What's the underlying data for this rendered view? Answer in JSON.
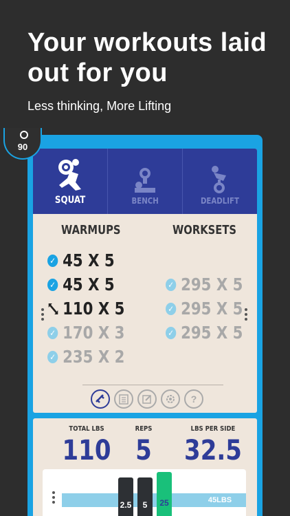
{
  "header": {
    "headline": "Your workouts laid out for you",
    "subline": "Less thinking, More Lifting"
  },
  "timer": {
    "value": "90"
  },
  "lifts": {
    "tabs": [
      {
        "label": "SQUAT",
        "active": true
      },
      {
        "label": "BENCH",
        "active": false
      },
      {
        "label": "DEADLIFT",
        "active": false
      }
    ]
  },
  "warmups": {
    "title": "WARMUPS",
    "sets": [
      {
        "text": "45 X 5",
        "status": "done"
      },
      {
        "text": "45 X 5",
        "status": "done"
      },
      {
        "text": "110 X 5",
        "status": "current"
      },
      {
        "text": "170 X 3",
        "status": "pending"
      },
      {
        "text": "235 X 2",
        "status": "pending"
      }
    ]
  },
  "worksets": {
    "title": "WORKSETS",
    "sets": [
      {
        "text": "295 X 5",
        "status": "pending"
      },
      {
        "text": "295 X 5",
        "status": "pending"
      },
      {
        "text": "295 X 5",
        "status": "pending"
      }
    ]
  },
  "toolbar": {
    "icons": [
      "plate-calculator-icon",
      "notes-icon",
      "edit-icon",
      "settings-icon",
      "help-icon"
    ],
    "help_glyph": "?"
  },
  "stats": {
    "total_label": "TOTAL LBS",
    "total_value": "110",
    "reps_label": "REPS",
    "reps_value": "5",
    "per_side_label": "LBS PER SIDE",
    "per_side_value": "32.5"
  },
  "plates": {
    "items": [
      "2.5",
      "5",
      "25"
    ],
    "bar_weight": "45LBS"
  },
  "colors": {
    "background": "#2d2d2d",
    "device": "#1aa3e3",
    "card": "#efe6dc",
    "accent": "#2e3c98",
    "check": "#1aa3e3",
    "green_plate": "#19c07a"
  }
}
